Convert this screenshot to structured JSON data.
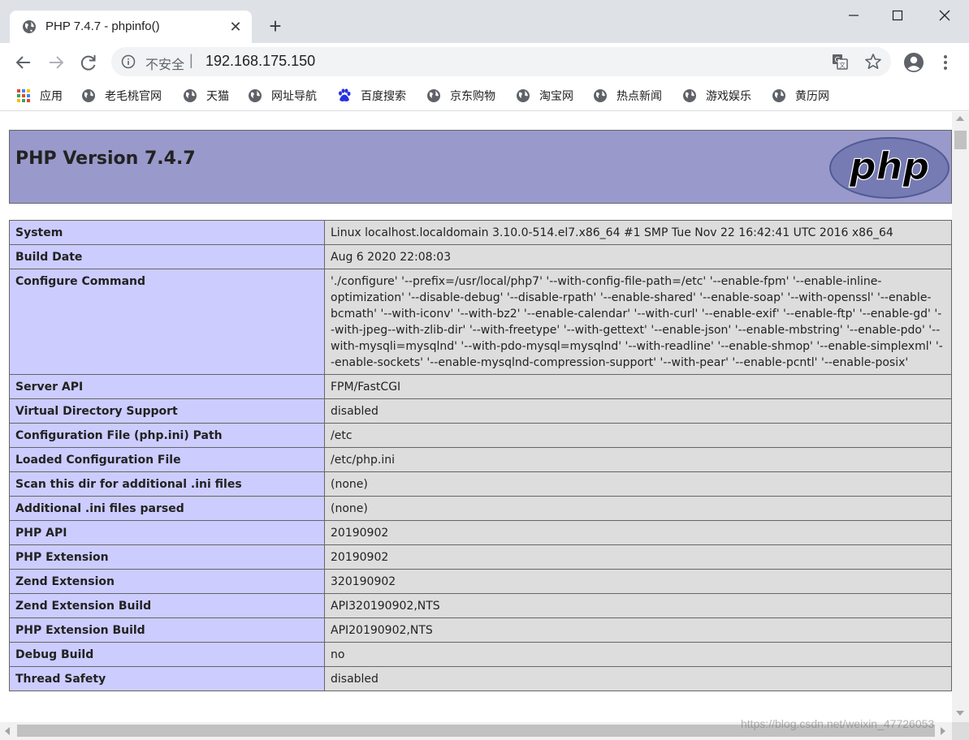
{
  "browser": {
    "tab": {
      "title": "PHP 7.4.7 - phpinfo()",
      "close_glyph": "✕"
    },
    "new_tab_glyph": "+",
    "omnibox": {
      "security_label": "不安全",
      "separator": "|",
      "url": "192.168.175.150"
    },
    "bookmarks": [
      {
        "label": "应用",
        "icon": "apps-grid-icon"
      },
      {
        "label": "老毛桃官网",
        "icon": "globe-icon"
      },
      {
        "label": "天猫",
        "icon": "globe-icon"
      },
      {
        "label": "网址导航",
        "icon": "globe-icon"
      },
      {
        "label": "百度搜索",
        "icon": "baidu-paw-icon"
      },
      {
        "label": "京东购物",
        "icon": "globe-icon"
      },
      {
        "label": "淘宝网",
        "icon": "globe-icon"
      },
      {
        "label": "热点新闻",
        "icon": "globe-icon"
      },
      {
        "label": "游戏娱乐",
        "icon": "globe-icon"
      },
      {
        "label": "黄历网",
        "icon": "globe-icon"
      }
    ]
  },
  "page": {
    "header_title": "PHP Version 7.4.7",
    "logo_text": "php",
    "rows": [
      {
        "key": "System",
        "value": "Linux localhost.localdomain 3.10.0-514.el7.x86_64 #1 SMP Tue Nov 22 16:42:41 UTC 2016 x86_64"
      },
      {
        "key": "Build Date",
        "value": "Aug 6 2020 22:08:03"
      },
      {
        "key": "Configure Command",
        "value": "'./configure' '--prefix=/usr/local/php7' '--with-config-file-path=/etc' '--enable-fpm' '--enable-inline-optimization' '--disable-debug' '--disable-rpath' '--enable-shared' '--enable-soap' '--with-openssl' '--enable-bcmath' '--with-iconv' '--with-bz2' '--enable-calendar' '--with-curl' '--enable-exif' '--enable-ftp' '--enable-gd' '--with-jpeg--with-zlib-dir' '--with-freetype' '--with-gettext' '--enable-json' '--enable-mbstring' '--enable-pdo' '--with-mysqli=mysqlnd' '--with-pdo-mysql=mysqlnd' '--with-readline' '--enable-shmop' '--enable-simplexml' '--enable-sockets' '--enable-mysqlnd-compression-support' '--with-pear' '--enable-pcntl' '--enable-posix'"
      },
      {
        "key": "Server API",
        "value": "FPM/FastCGI"
      },
      {
        "key": "Virtual Directory Support",
        "value": "disabled"
      },
      {
        "key": "Configuration File (php.ini) Path",
        "value": "/etc"
      },
      {
        "key": "Loaded Configuration File",
        "value": "/etc/php.ini"
      },
      {
        "key": "Scan this dir for additional .ini files",
        "value": "(none)"
      },
      {
        "key": "Additional .ini files parsed",
        "value": "(none)"
      },
      {
        "key": "PHP API",
        "value": "20190902"
      },
      {
        "key": "PHP Extension",
        "value": "20190902"
      },
      {
        "key": "Zend Extension",
        "value": "320190902"
      },
      {
        "key": "Zend Extension Build",
        "value": "API320190902,NTS"
      },
      {
        "key": "PHP Extension Build",
        "value": "API20190902,NTS"
      },
      {
        "key": "Debug Build",
        "value": "no"
      },
      {
        "key": "Thread Safety",
        "value": "disabled"
      }
    ]
  },
  "watermark": "https://blog.csdn.net/weixin_47726053",
  "colors": {
    "header_bg": "#9999cc",
    "key_cell_bg": "#ccccff",
    "value_cell_bg": "#dddddd",
    "tabstrip_bg": "#dee1e6",
    "logo_bg": "#777bb3"
  }
}
